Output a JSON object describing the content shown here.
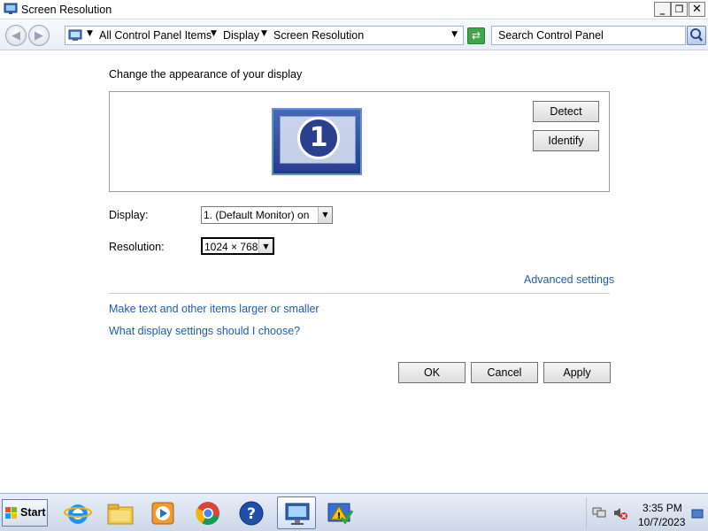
{
  "window": {
    "title": "Screen Resolution"
  },
  "window_controls": {
    "minimize": "_",
    "maximize": "❐",
    "close": "✕"
  },
  "address_bar": {
    "crumbs": [
      "All Control Panel Items",
      "Display",
      "Screen Resolution"
    ],
    "search_placeholder": "Search Control Panel"
  },
  "content": {
    "heading": "Change the appearance of your display",
    "monitor_number": "1",
    "detect_label": "Detect",
    "identify_label": "Identify",
    "display_label": "Display:",
    "display_value": "1. (Default Monitor) on",
    "resolution_label": "Resolution:",
    "resolution_value": "1024 × 768",
    "advanced_link": "Advanced settings",
    "larger_link": "Make text and other items larger or smaller",
    "which_link": "What display settings should I choose?",
    "ok_label": "OK",
    "cancel_label": "Cancel",
    "apply_label": "Apply"
  },
  "taskbar": {
    "start_label": "Start",
    "items": [
      "internet-explorer-icon",
      "file-explorer-icon",
      "media-player-icon",
      "chrome-icon",
      "help-icon",
      "display-settings-icon",
      "action-center-icon"
    ],
    "clock_time": "3:35 PM",
    "clock_date": "10/7/2023"
  },
  "colors": {
    "link": "#1e5bb3",
    "accent": "#3f6fb9"
  }
}
